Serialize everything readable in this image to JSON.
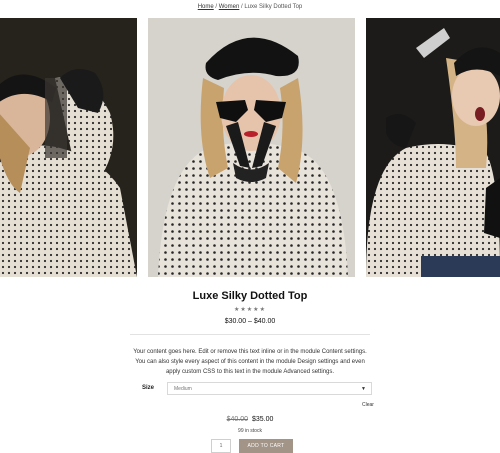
{
  "breadcrumb": {
    "home": "Home",
    "sep1": " / ",
    "category": "Women",
    "sep2": " / ",
    "current": "Luxe Silky Dotted Top"
  },
  "product": {
    "title": "Luxe Silky Dotted Top",
    "rating_stars": "★★★★★",
    "rating_value": 0,
    "rating_max": 5,
    "price_range": "$30.00 – $40.00",
    "description": "Your content goes here. Edit or remove this text inline or in the module Content settings. You can also style every aspect of this content in the module Design settings and even apply custom CSS to this text in the module Advanced settings."
  },
  "options": {
    "size_label": "Size",
    "size_selected": "Medium",
    "clear_label": "Clear"
  },
  "variation": {
    "old_price": "$40.00",
    "new_price": "$35.00",
    "stock": "99 in stock"
  },
  "cart": {
    "quantity": "1",
    "add_to_cart": "ADD TO CART"
  },
  "colors": {
    "accent": "#a29487"
  }
}
